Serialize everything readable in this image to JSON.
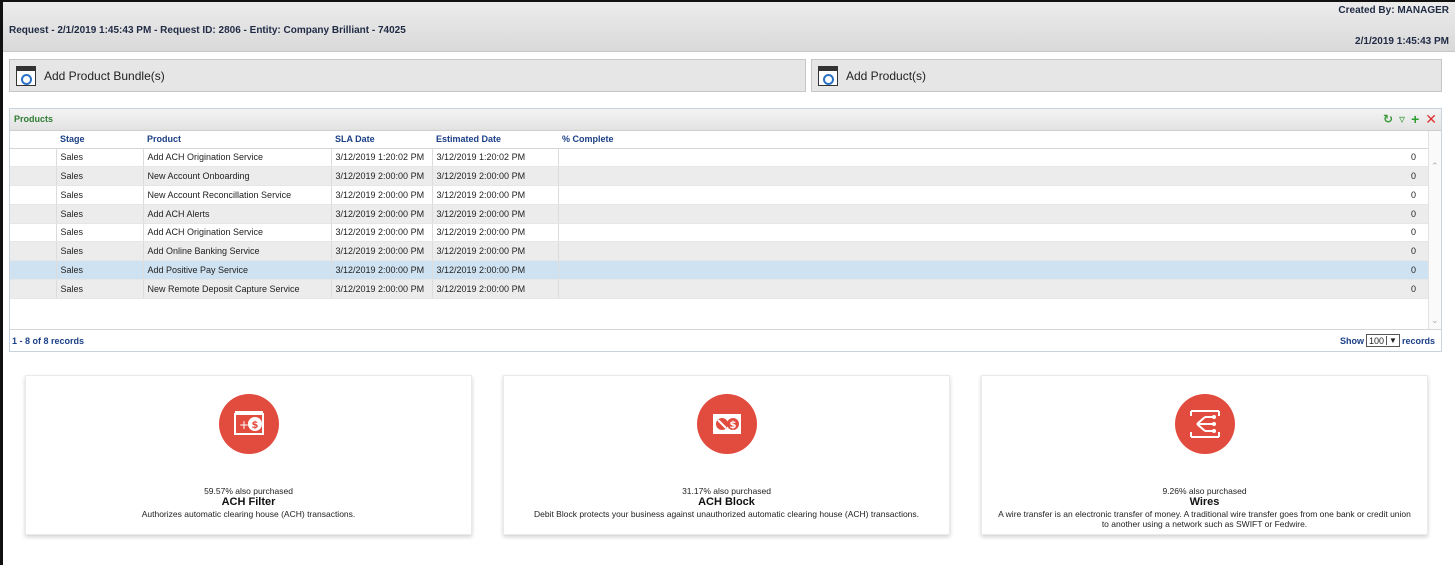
{
  "header": {
    "title": "Request - 2/1/2019 1:45:43 PM - Request ID: 2806 - Entity: Company Brilliant - 74025",
    "created_by": "Created By: MANAGER",
    "created_date": "2/1/2019 1:45:43 PM"
  },
  "actions": {
    "add_bundle_label": "Add Product Bundle(s)",
    "add_product_label": "Add Product(s)"
  },
  "products": {
    "title": "Products",
    "toolbar_icons": [
      "refresh-icon",
      "filter-icon",
      "add-icon",
      "delete-icon"
    ],
    "columns": [
      "Stage",
      "Product",
      "SLA Date",
      "Estimated Date",
      "% Complete"
    ],
    "rows": [
      {
        "stage": "Sales",
        "product": "Add ACH Origination Service",
        "sla": "3/12/2019 1:20:02 PM",
        "est": "3/12/2019 1:20:02 PM",
        "pct": "0"
      },
      {
        "stage": "Sales",
        "product": "New Account Onboarding",
        "sla": "3/12/2019 2:00:00 PM",
        "est": "3/12/2019 2:00:00 PM",
        "pct": "0"
      },
      {
        "stage": "Sales",
        "product": "New Account Reconcillation Service",
        "sla": "3/12/2019 2:00:00 PM",
        "est": "3/12/2019 2:00:00 PM",
        "pct": "0"
      },
      {
        "stage": "Sales",
        "product": "Add ACH Alerts",
        "sla": "3/12/2019 2:00:00 PM",
        "est": "3/12/2019 2:00:00 PM",
        "pct": "0"
      },
      {
        "stage": "Sales",
        "product": "Add ACH Origination Service",
        "sla": "3/12/2019 2:00:00 PM",
        "est": "3/12/2019 2:00:00 PM",
        "pct": "0"
      },
      {
        "stage": "Sales",
        "product": "Add Online Banking Service",
        "sla": "3/12/2019 2:00:00 PM",
        "est": "3/12/2019 2:00:00 PM",
        "pct": "0"
      },
      {
        "stage": "Sales",
        "product": "Add Positive Pay Service",
        "sla": "3/12/2019 2:00:00 PM",
        "est": "3/12/2019 2:00:00 PM",
        "pct": "0"
      },
      {
        "stage": "Sales",
        "product": "New Remote Deposit Capture Service",
        "sla": "3/12/2019 2:00:00 PM",
        "est": "3/12/2019 2:00:00 PM",
        "pct": "0"
      }
    ],
    "selected_row": 6,
    "record_count": "1 - 8 of 8 records",
    "show_label": "Show",
    "page_size": "100",
    "records_label": "records"
  },
  "cards": [
    {
      "percent": "59.57% also purchased",
      "name": "ACH Filter",
      "description": "Authorizes automatic clearing house (ACH) transactions.",
      "icon": "ach-filter-icon"
    },
    {
      "percent": "31.17% also purchased",
      "name": "ACH Block",
      "description": "Debit Block protects your business against unauthorized automatic clearing house (ACH) transactions.",
      "icon": "ach-block-icon"
    },
    {
      "percent": "9.26% also purchased",
      "name": "Wires",
      "description": "A wire transfer is an electronic transfer of money. A traditional wire transfer goes from one bank or credit union to another using a network such as SWIFT or Fedwire.",
      "icon": "wire-transfer-icon"
    }
  ],
  "colors": {
    "accent_red": "#e24c3f",
    "header_blue": "#1b3f86",
    "products_green": "#2e7d32",
    "selected_row": "#cfe2f1"
  }
}
